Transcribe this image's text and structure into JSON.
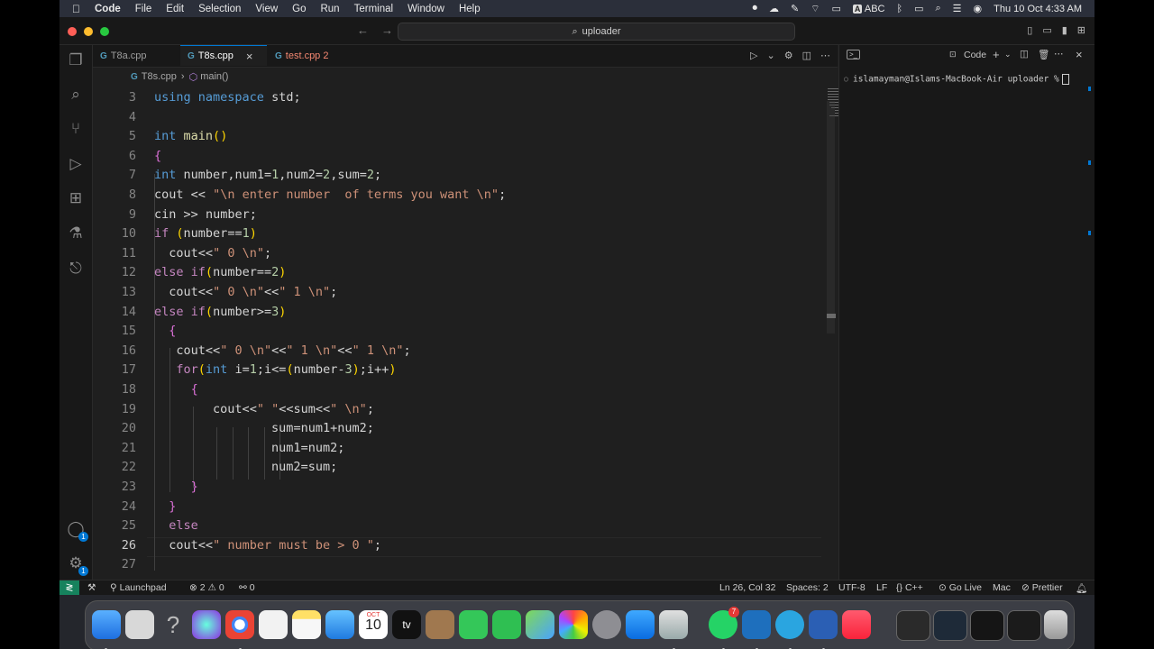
{
  "menubar": {
    "app_name": "Code",
    "items": [
      "File",
      "Edit",
      "Selection",
      "View",
      "Go",
      "Run",
      "Terminal",
      "Window",
      "Help"
    ],
    "input_label": "ABC",
    "clock": "Thu 10 Oct  4:33 AM"
  },
  "titlebar": {
    "search_text": "uploader"
  },
  "tabs": [
    {
      "icon": "G",
      "label": "T8a.cpp"
    },
    {
      "icon": "G",
      "label": "T8s.cpp",
      "close": "×"
    },
    {
      "icon": "G",
      "label": "test.cpp 2"
    }
  ],
  "breadcrumb": {
    "file": "T8s.cpp",
    "separator": "›",
    "symbol": "main()"
  },
  "editor": {
    "lines": [
      {
        "n": "3",
        "text": "using namespace std;"
      },
      {
        "n": "4",
        "text": ""
      },
      {
        "n": "5",
        "text": "int main()"
      },
      {
        "n": "6",
        "text": "{"
      },
      {
        "n": "7",
        "text": "int number,num1=1,num2=2,sum=2;"
      },
      {
        "n": "8",
        "text": "cout << \"\\n enter number  of terms you want \\n\";"
      },
      {
        "n": "9",
        "text": "cin >> number;"
      },
      {
        "n": "10",
        "text": "if (number==1)"
      },
      {
        "n": "11",
        "text": "  cout<<\" 0 \\n\";"
      },
      {
        "n": "12",
        "text": "else if(number==2)"
      },
      {
        "n": "13",
        "text": "  cout<<\" 0 \\n\"<<\" 1 \\n\";"
      },
      {
        "n": "14",
        "text": "else if(number>=3)"
      },
      {
        "n": "15",
        "text": "  {"
      },
      {
        "n": "16",
        "text": "   cout<<\" 0 \\n\"<<\" 1 \\n\"<<\" 1 \\n\";"
      },
      {
        "n": "17",
        "text": "   for(int i=1;i<=(number-3);i++)"
      },
      {
        "n": "18",
        "text": "     {"
      },
      {
        "n": "19",
        "text": "        cout<<\" \"<<sum<<\" \\n\";"
      },
      {
        "n": "20",
        "text": "                sum=num1+num2;"
      },
      {
        "n": "21",
        "text": "                num1=num2;"
      },
      {
        "n": "22",
        "text": "                num2=sum;"
      },
      {
        "n": "23",
        "text": "     }"
      },
      {
        "n": "24",
        "text": "  }"
      },
      {
        "n": "25",
        "text": "  else"
      },
      {
        "n": "26",
        "text": "  cout<<\" number must be > 0 \";"
      },
      {
        "n": "27",
        "text": ""
      }
    ]
  },
  "panel": {
    "title": "Code",
    "prompt": "islamayman@Islams-MacBook-Air uploader %"
  },
  "statusbar": {
    "launchpad": "Launchpad",
    "errors": "2",
    "warnings": "0",
    "ports": "0",
    "position": "Ln 26, Col 32",
    "spaces": "Spaces: 2",
    "encoding": "UTF-8",
    "eol": "LF",
    "language": "C++",
    "golive": "Go Live",
    "platform": "Mac",
    "prettier": "Prettier"
  },
  "dock": {
    "calendar_month": "OCT",
    "calendar_day": "10",
    "whatsapp_badge": "7",
    "appletv": "tv"
  },
  "activity_badges": {
    "accounts": "1",
    "settings": "1"
  }
}
